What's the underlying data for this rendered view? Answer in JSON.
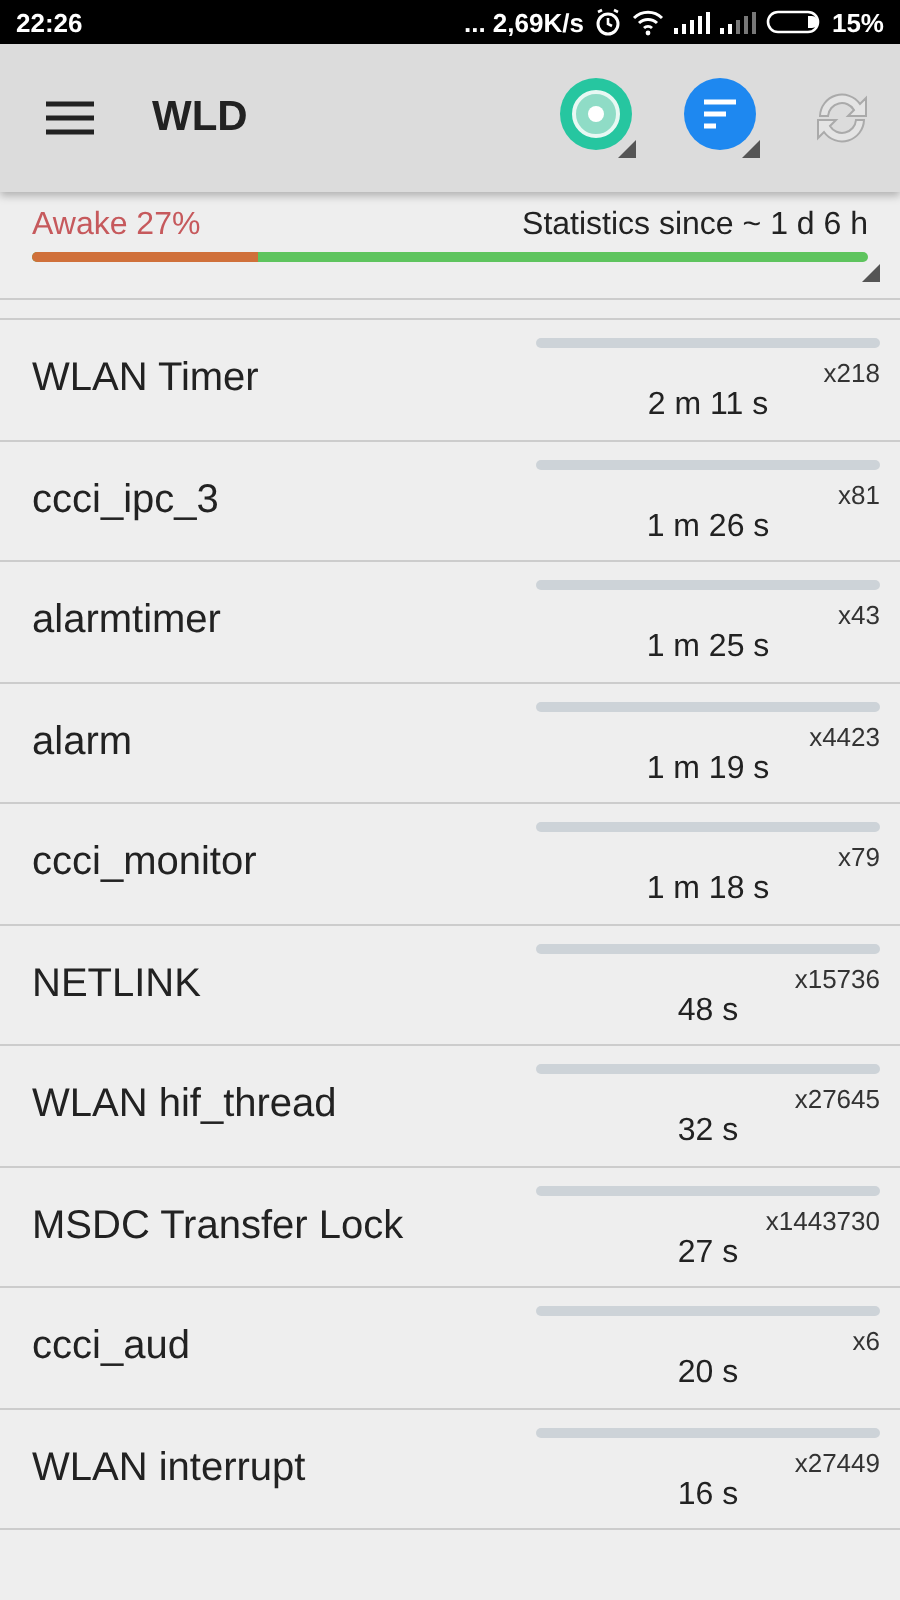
{
  "status_bar": {
    "time": "22:26",
    "speed": "... 2,69K/s",
    "battery": "15%"
  },
  "toolbar": {
    "title": "WLD"
  },
  "summary": {
    "awake": "Awake 27%",
    "since": "Statistics since ~ 1 d 6 h",
    "level": 0.27
  },
  "rows": [
    {
      "name": "WLAN Timer",
      "count": "x218",
      "time": "2 m 11 s"
    },
    {
      "name": "ccci_ipc_3",
      "count": "x81",
      "time": "1 m 26 s"
    },
    {
      "name": "alarmtimer",
      "count": "x43",
      "time": "1 m 25 s"
    },
    {
      "name": "alarm",
      "count": "x4423",
      "time": "1 m 19 s"
    },
    {
      "name": "ccci_monitor",
      "count": "x79",
      "time": "1 m 18 s"
    },
    {
      "name": "NETLINK",
      "count": "x15736",
      "time": "48 s"
    },
    {
      "name": "WLAN hif_thread",
      "count": "x27645",
      "time": "32 s"
    },
    {
      "name": "MSDC Transfer Lock",
      "count": "x1443730",
      "time": "27 s"
    },
    {
      "name": "ccci_aud",
      "count": "x6",
      "time": "20 s"
    },
    {
      "name": "WLAN interrupt",
      "count": "x27449",
      "time": "16 s"
    }
  ]
}
